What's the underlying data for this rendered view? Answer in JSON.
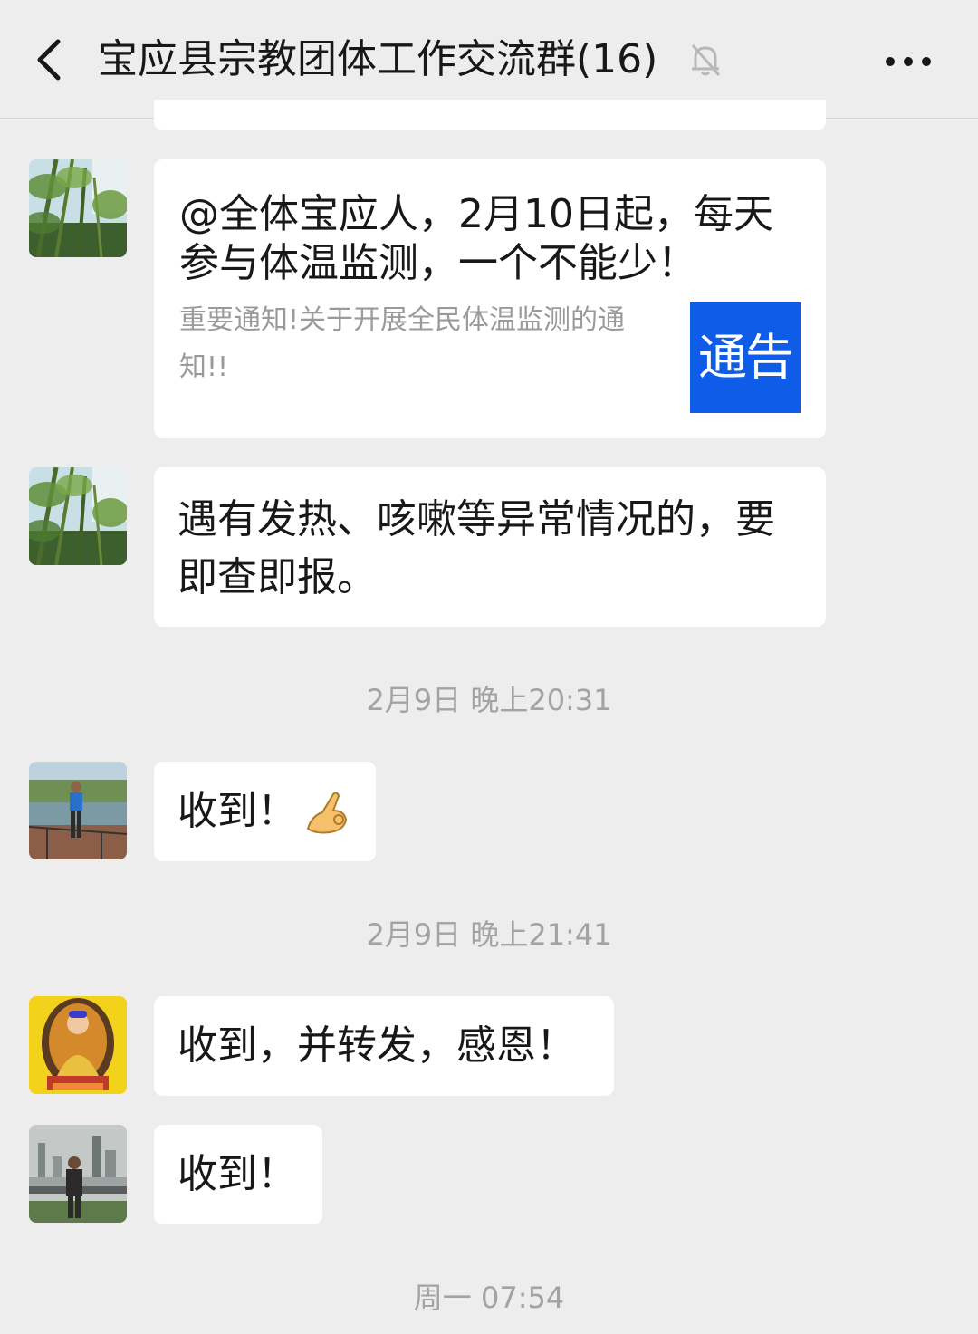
{
  "header": {
    "title": "宝应县宗教团体工作交流群(16)",
    "back_icon": "chevron-left-icon",
    "mute_icon": "bell-muted-icon",
    "more_icon": "more-dots-icon"
  },
  "messages": [
    {
      "type": "link-card",
      "avatar": "bamboo-forest-avatar",
      "title": "@全体宝应人，2月10日起，每天参与体温监测，一个不能少！",
      "description": "重要通知!关于开展全民体温监测的通知!!",
      "thumb_text": "通告",
      "thumb_color": "#0f5ce8"
    },
    {
      "type": "text",
      "avatar": "bamboo-forest-avatar",
      "text": "遇有发热、咳嗽等异常情况的，要即查即报。"
    },
    {
      "type": "timestamp",
      "text": "2月9日 晚上20:31"
    },
    {
      "type": "text",
      "avatar": "riverside-man-avatar",
      "text": "收到！",
      "emoji": "👌"
    },
    {
      "type": "timestamp",
      "text": "2月9日 晚上21:41"
    },
    {
      "type": "text",
      "avatar": "buddha-avatar",
      "text": "收到，并转发，感恩！"
    },
    {
      "type": "text",
      "avatar": "city-skyline-man-avatar",
      "text": "收到！"
    },
    {
      "type": "timestamp",
      "text": "周一 07:54"
    }
  ],
  "colors": {
    "background": "#ededed",
    "bubble": "#ffffff",
    "text": "#181818",
    "timestamp": "#a3a3a3"
  }
}
